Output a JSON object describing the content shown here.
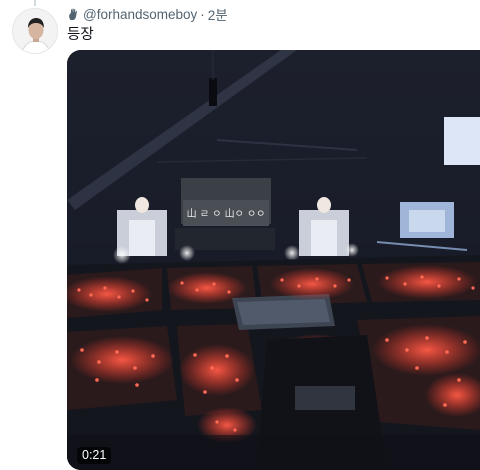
{
  "tweet": {
    "handle": "@forhandsomeboy",
    "separator": "·",
    "time": "2분",
    "text": "등장",
    "header_icon": "raised-hand-icon"
  },
  "video": {
    "duration": "0:21",
    "stage_screen_text": "山 ㄹ ㅇ 山ㅇ ㅇㅇ"
  },
  "colors": {
    "handle": "#536471",
    "text": "#0f1419",
    "lightstick": "#e8483a",
    "stage_light": "#e6f0ff"
  }
}
